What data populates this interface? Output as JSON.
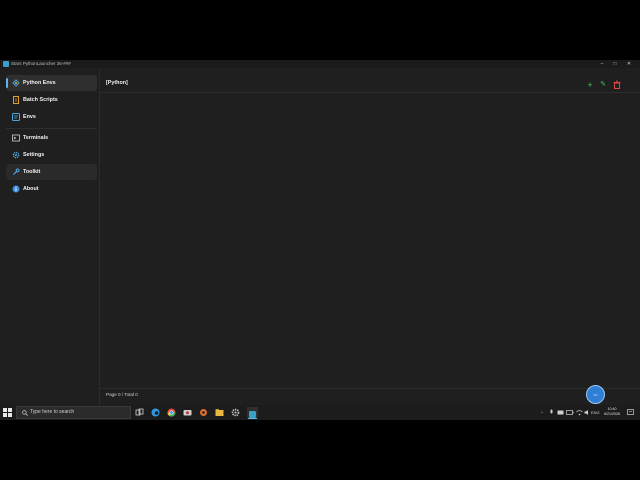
{
  "window": {
    "title": "Stars PythonLauncher 36-###",
    "minimize": "–",
    "maximize": "□",
    "close": "✕"
  },
  "sidebar": {
    "items": [
      {
        "label": "Python Envs",
        "icon": "python-icon",
        "icon_color": "#4ea6dc"
      },
      {
        "label": "Batch Scripts",
        "icon": "script-icon",
        "icon_color": "#e0a030"
      },
      {
        "label": "Envs",
        "icon": "code-icon",
        "icon_color": "#4ea6dc"
      },
      {
        "label": "Terminals",
        "icon": "terminal-icon",
        "icon_color": "#cfcfcf"
      },
      {
        "label": "Settings",
        "icon": "gear-icon",
        "icon_color": "#4ea6dc"
      },
      {
        "label": "Toolkit",
        "icon": "wrench-icon",
        "icon_color": "#4ea6dc"
      },
      {
        "label": "About",
        "icon": "info-icon",
        "icon_color": "#3b8fe0"
      }
    ]
  },
  "main": {
    "title": "[Python]",
    "actions": {
      "add": "+",
      "edit": "✎",
      "delete": "🗑"
    },
    "pager": "Page 0 / Total 0",
    "fab_label": "•••"
  },
  "taskbar": {
    "search_placeholder": "Type here to search",
    "apps": [
      "task-view-icon",
      "edge-icon",
      "chrome-icon",
      "camera-icon",
      "app-icon",
      "explorer-icon",
      "settings-icon",
      "launcher-icon"
    ],
    "tray_text": "ENG",
    "time": "10:40",
    "date": "6/21/2026"
  },
  "colors": {
    "accent": "#5fb3e6",
    "add": "#3cc45a",
    "edit": "#3cc45a",
    "delete": "#e04646"
  }
}
